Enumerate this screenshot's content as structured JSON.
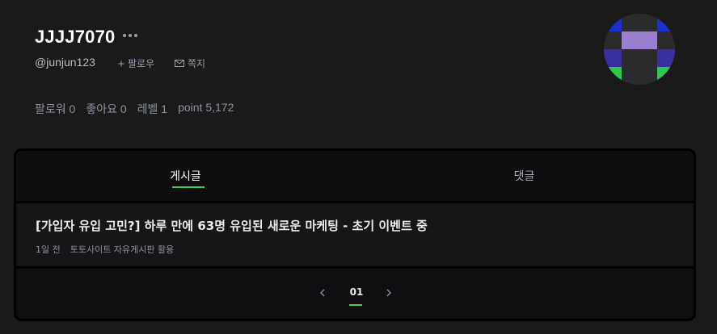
{
  "profile": {
    "username": "JJJJ7070",
    "handle": "@junjun123",
    "follow_label": "팔로우",
    "message_label": "쪽지",
    "stats": {
      "followers": "팔로워 0",
      "likes": "좋아요 0",
      "level": "레벨 1",
      "points": "point 5,172"
    },
    "avatar_colors": {
      "background": "#2b2b2e",
      "top": "#1c2fd0",
      "middle": "#3a2fa0",
      "center": "#9a7fd0",
      "bottom": "#2ec84a"
    }
  },
  "tabs": [
    {
      "label": "게시글",
      "active": true
    },
    {
      "label": "댓글",
      "active": false
    }
  ],
  "posts": [
    {
      "title": "[가입자 유입 고민?] 하루 만에 63명 유입된 새로운 마케팅 - 초기 이벤트 중",
      "time": "1일 전",
      "board": "토토사이트 자유게시판 활용"
    }
  ],
  "pagination": {
    "current": "01"
  },
  "colors": {
    "accent": "#3ccf5a",
    "page_bg": "#1a1a1b",
    "card_bg": "#0b0b0d"
  }
}
